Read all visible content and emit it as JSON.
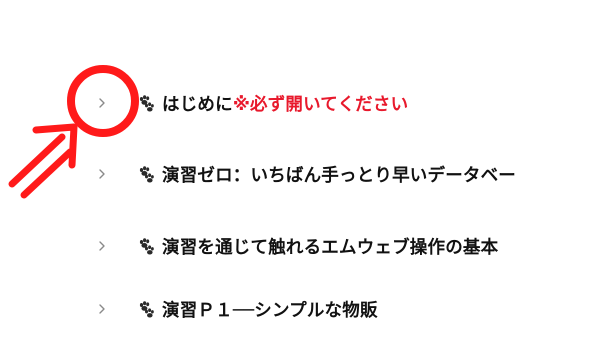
{
  "toggle_list": {
    "items": [
      {
        "icon": "paw-prints-icon",
        "label": "はじめに",
        "label_accent": "※必ず開いてください"
      },
      {
        "icon": "paw-prints-icon",
        "label": "演習ゼロ：いちばん手っとり早いデータベー"
      },
      {
        "icon": "paw-prints-icon",
        "label": "演習を通じて触れるエムウェブ操作の基本"
      },
      {
        "icon": "paw-prints-icon",
        "label": "演習Ｐ１──シンプルな物販"
      }
    ]
  },
  "annotation": {
    "shape": "circle-and-arrow",
    "color": "#ff1a1a"
  },
  "colors": {
    "text": "#111111",
    "accent": "#e8192c",
    "chevron": "#8a8a8a"
  }
}
